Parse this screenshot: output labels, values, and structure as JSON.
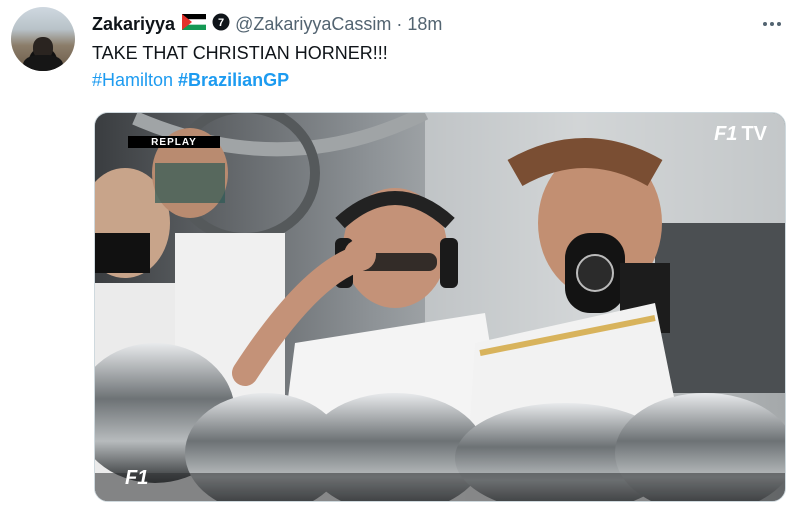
{
  "tweet": {
    "display_name": "Zakariyya",
    "handle": "@ZakariyyaCassim",
    "separator": "·",
    "time": "18m",
    "text": "TAKE THAT CHRISTIAN HORNER!!!",
    "hashtags": [
      "#Hamilton",
      "#BrazilianGP"
    ]
  },
  "media": {
    "replay_label": "REPLAY",
    "watermark_logo": "F1",
    "watermark_suffix": "TV",
    "bottom_logo": "F1"
  },
  "icons": {
    "flag": "palestine-flag-icon",
    "verified": "verified-badge-icon",
    "more": "more-options-icon"
  },
  "colors": {
    "link": "#1d9bf0",
    "secondary_text": "#536471",
    "primary_text": "#0f1419"
  }
}
